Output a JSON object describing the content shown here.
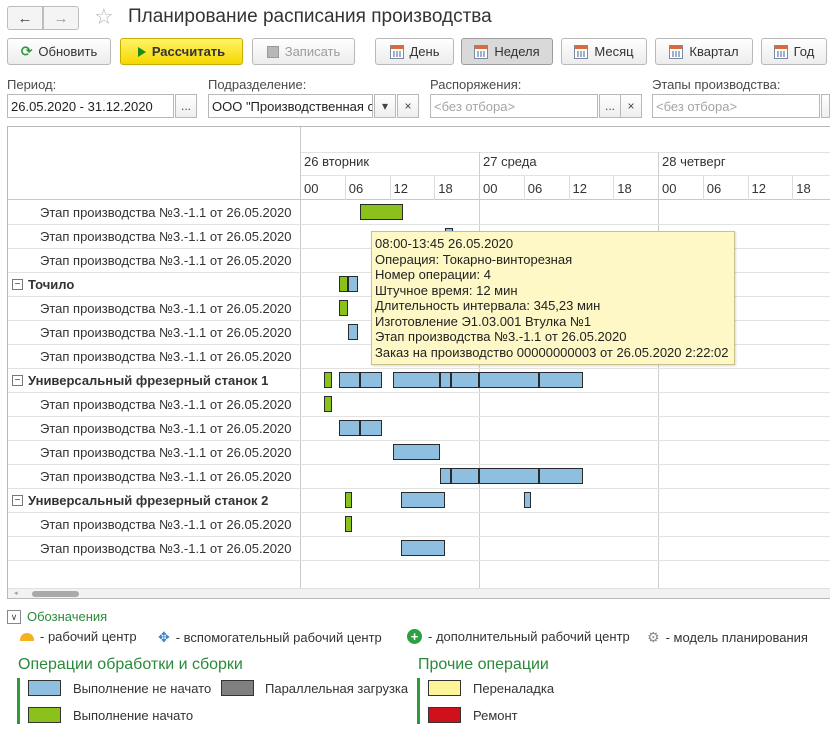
{
  "window": {
    "title": "Планирование расписания производства",
    "back_icon": "←",
    "forward_icon": "→",
    "star_icon": "☆"
  },
  "toolbar": {
    "refresh": "Обновить",
    "calculate": "Рассчитать",
    "save": "Записать",
    "day": "День",
    "week": "Неделя",
    "month": "Месяц",
    "quarter": "Квартал",
    "year": "Год",
    "active_scale": "week"
  },
  "filters": {
    "period_label": "Период:",
    "period_value": "26.05.2020 - 31.12.2020",
    "division_label": "Подразделение:",
    "division_value": "ООО \"Производственная с",
    "orders_label": "Распоряжения:",
    "orders_placeholder": "<без отбора>",
    "stages_label": "Этапы производства:",
    "stages_placeholder": "<без отбора>",
    "select_btn": "...",
    "clear_btn": "×",
    "dropdown_btn": "▾"
  },
  "gantt": {
    "days": [
      "26 вторник",
      "27 среда",
      "28 четверг"
    ],
    "hours": [
      "00",
      "06",
      "12",
      "18"
    ],
    "rows": [
      {
        "type": "child",
        "label": "Этап производства №3.-1.1 от 26.05.2020"
      },
      {
        "type": "child",
        "label": "Этап производства №3.-1.1 от 26.05.2020"
      },
      {
        "type": "child",
        "label": "Этап производства №3.-1.1 от 26.05.2020"
      },
      {
        "type": "group",
        "label": "Точило"
      },
      {
        "type": "child",
        "label": "Этап производства №3.-1.1 от 26.05.2020"
      },
      {
        "type": "child",
        "label": "Этап производства №3.-1.1 от 26.05.2020"
      },
      {
        "type": "child",
        "label": "Этап производства №3.-1.1 от 26.05.2020"
      },
      {
        "type": "group",
        "label": "Универсальный фрезерный станок 1"
      },
      {
        "type": "child",
        "label": "Этап производства №3.-1.1 от 26.05.2020"
      },
      {
        "type": "child",
        "label": "Этап производства №3.-1.1 от 26.05.2020"
      },
      {
        "type": "child",
        "label": "Этап производства №3.-1.1 от 26.05.2020"
      },
      {
        "type": "child",
        "label": "Этап производства №3.-1.1 от 26.05.2020"
      },
      {
        "type": "group",
        "label": "Универсальный фрезерный станок 2"
      },
      {
        "type": "child",
        "label": "Этап производства №3.-1.1 от 26.05.2020"
      },
      {
        "type": "child",
        "label": "Этап производства №3.-1.1 от 26.05.2020"
      }
    ],
    "bars": [
      {
        "row": 0,
        "start": 8.0,
        "end": 13.75,
        "status": "started"
      },
      {
        "row": 1,
        "start": 19.5,
        "end": 20.5,
        "status": "not_started"
      },
      {
        "row": 3,
        "start": 5.25,
        "end": 6.5,
        "status": "started"
      },
      {
        "row": 3,
        "start": 6.5,
        "end": 7.75,
        "status": "not_started"
      },
      {
        "row": 4,
        "start": 5.25,
        "end": 6.5,
        "status": "started"
      },
      {
        "row": 5,
        "start": 6.5,
        "end": 7.75,
        "status": "not_started"
      },
      {
        "row": 6,
        "start": 28.0,
        "end": 29.25,
        "status": "not_started"
      },
      {
        "row": 7,
        "start": 3.25,
        "end": 4.25,
        "status": "started"
      },
      {
        "row": 7,
        "start": 5.25,
        "end": 8.0,
        "status": "not_started"
      },
      {
        "row": 7,
        "start": 8.0,
        "end": 11.0,
        "status": "not_started"
      },
      {
        "row": 7,
        "start": 12.5,
        "end": 18.75,
        "status": "not_started"
      },
      {
        "row": 7,
        "start": 18.75,
        "end": 20.25,
        "status": "not_started"
      },
      {
        "row": 7,
        "start": 20.25,
        "end": 24.0,
        "status": "not_started"
      },
      {
        "row": 7,
        "start": 24.0,
        "end": 32.0,
        "status": "not_started"
      },
      {
        "row": 7,
        "start": 32.0,
        "end": 38.0,
        "status": "not_started"
      },
      {
        "row": 8,
        "start": 3.25,
        "end": 4.25,
        "status": "started"
      },
      {
        "row": 9,
        "start": 5.25,
        "end": 8.0,
        "status": "not_started"
      },
      {
        "row": 9,
        "start": 8.0,
        "end": 11.0,
        "status": "not_started"
      },
      {
        "row": 10,
        "start": 12.5,
        "end": 18.75,
        "status": "not_started"
      },
      {
        "row": 11,
        "start": 18.75,
        "end": 20.25,
        "status": "not_started"
      },
      {
        "row": 11,
        "start": 20.25,
        "end": 24.0,
        "status": "not_started"
      },
      {
        "row": 11,
        "start": 24.0,
        "end": 32.0,
        "status": "not_started"
      },
      {
        "row": 11,
        "start": 32.0,
        "end": 38.0,
        "status": "not_started"
      },
      {
        "row": 12,
        "start": 6.0,
        "end": 7.0,
        "status": "started"
      },
      {
        "row": 12,
        "start": 13.5,
        "end": 19.5,
        "status": "not_started"
      },
      {
        "row": 12,
        "start": 30.0,
        "end": 31.0,
        "status": "not_started"
      },
      {
        "row": 13,
        "start": 6.0,
        "end": 7.0,
        "status": "started"
      },
      {
        "row": 14,
        "start": 13.5,
        "end": 19.5,
        "status": "not_started"
      }
    ],
    "tooltip": [
      "08:00-13:45 26.05.2020",
      "Операция: Токарно-винторезная",
      "Номер операции: 4",
      "Штучное время: 12 мин",
      "Длительность интервала: 345,23 мин",
      "Изготовление Э1.03.001 Втулка №1",
      "Этап производства №3.-1.1 от 26.05.2020",
      "Заказ на производство 00000000003 от 26.05.2020 2:22:02"
    ]
  },
  "legend": {
    "toggle_icon": "∨",
    "title": "Обозначения",
    "icons": [
      {
        "icon": "work-center-icon",
        "label": "- рабочий центр"
      },
      {
        "icon": "auxiliary-work-center-icon",
        "label": "- вспомогательный рабочий центр"
      },
      {
        "icon": "additional-work-center-icon",
        "label": "- дополнительный рабочий центр"
      },
      {
        "icon": "planning-model-icon",
        "label": "- модель планирования"
      }
    ],
    "processing_title": "Операции обработки и сборки",
    "not_started": "Выполнение не начато",
    "started": "Выполнение начато",
    "parallel": "Параллельная загрузка",
    "other_title": "Прочие операции",
    "changeover": "Переналадка",
    "repair": "Ремонт"
  },
  "colors": {
    "not_started": "#8fbfe0",
    "started": "#8bc11b",
    "parallel": "#7f7f7f",
    "changeover": "#fdf59a",
    "repair": "#d0101a",
    "accent_green": "#2a8a3a",
    "primary_button": "#f5d800"
  }
}
